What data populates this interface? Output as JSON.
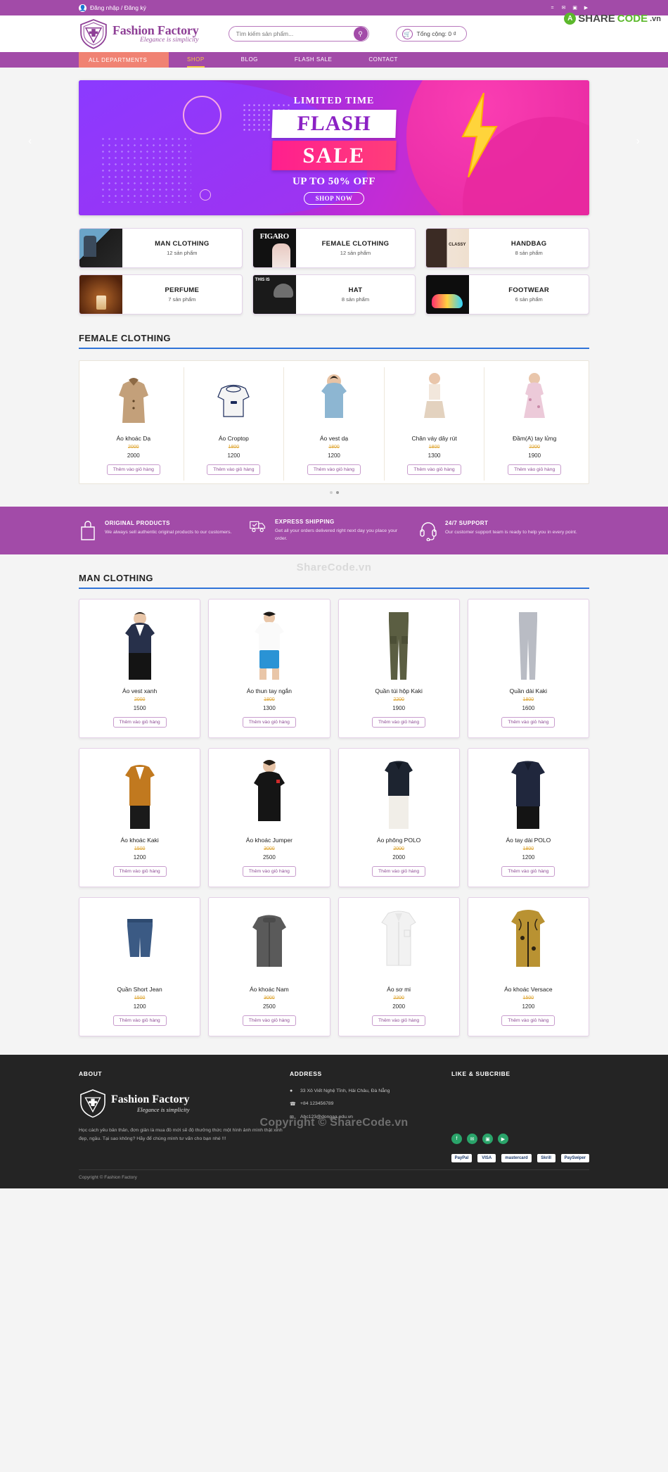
{
  "topbar": {
    "account_label": "Đăng nhập / Đăng ký",
    "user_icon": "user-icon",
    "socials": [
      "facebook-icon",
      "twitter-icon",
      "instagram-icon",
      "youtube-icon"
    ]
  },
  "sharecode": {
    "mark": "A",
    "share": "SHARE",
    "code": "CODE",
    "vn": ".vn"
  },
  "header": {
    "logo_title": "Fashion Factory",
    "logo_sub": "Elegance is simplicity",
    "search_placeholder": "Tìm kiếm sản phẩm...",
    "search_value": "",
    "search_icon": "search-icon",
    "cart_icon": "cart-icon",
    "cart_label": "Tổng cộng: 0 ₫"
  },
  "nav": {
    "all_departments": "ALL DEPARTMENTS",
    "links": [
      {
        "label": "SHOP",
        "active": true
      },
      {
        "label": "BLOG",
        "active": false
      },
      {
        "label": "FLASH SALE",
        "active": false
      },
      {
        "label": "CONTACT",
        "active": false
      }
    ]
  },
  "hero": {
    "limited": "LIMITED TIME",
    "flash": "FLASH",
    "sale": "SALE",
    "upto": "UP TO 50% OFF",
    "shop_now": "SHOP NOW",
    "prev_icon": "chevron-left-icon",
    "next_icon": "chevron-right-icon"
  },
  "categories": [
    {
      "name": "MAN CLOTHING",
      "count": "12 sản phẩm",
      "thumb": "th-man"
    },
    {
      "name": "FEMALE CLOTHING",
      "count": "12 sản phẩm",
      "thumb": "th-female"
    },
    {
      "name": "HANDBAG",
      "count": "8 sản phẩm",
      "thumb": "th-bag"
    },
    {
      "name": "PERFUME",
      "count": "7 sản phẩm",
      "thumb": "th-perfume"
    },
    {
      "name": "HAT",
      "count": "8 sản phẩm",
      "thumb": "th-hat"
    },
    {
      "name": "FOOTWEAR",
      "count": "6 sản phẩm",
      "thumb": "th-shoe"
    }
  ],
  "female_section": {
    "title": "FEMALE CLOTHING",
    "add_to_cart": "Thêm vào giỏ hàng",
    "products": [
      {
        "name": "Áo khoác Dạ",
        "old_price": "2000",
        "price": "2000",
        "color": "#c3a07a",
        "shape": "coat"
      },
      {
        "name": "Áo Croptop",
        "old_price": "1800",
        "price": "1200",
        "color": "#f2f2f2",
        "shape": "top"
      },
      {
        "name": "Áo vest dạ",
        "old_price": "1800",
        "price": "1200",
        "color": "#8db6d2",
        "shape": "denim"
      },
      {
        "name": "Chân váy dây rút",
        "old_price": "1800",
        "price": "1300",
        "color": "#e8d8c8",
        "shape": "skirt"
      },
      {
        "name": "Đầm(A) tay lửng",
        "old_price": "2200",
        "price": "1900",
        "color": "#e9c7d6",
        "shape": "dress"
      }
    ],
    "carousel_dots": 2,
    "active_dot": 1
  },
  "services": [
    {
      "icon": "bag-icon",
      "title": "ORIGINAL PRODUCTS",
      "desc": "We always sell authentic original products to our customers."
    },
    {
      "icon": "truck-icon",
      "title": "EXPRESS SHIPPING",
      "desc": "Get all your orders delivered right next day you place your order."
    },
    {
      "icon": "headset-icon",
      "title": "24/7 SUPPORT",
      "desc": "Our customer support team is ready to help you in every point."
    }
  ],
  "man_section": {
    "title": "MAN CLOTHING",
    "watermark": "ShareCode.vn",
    "add_to_cart": "Thêm vào giỏ hàng",
    "products": [
      {
        "name": "Áo vest xanh",
        "old_price": "2000",
        "price": "1500",
        "color": "#27304a",
        "shape": "suit"
      },
      {
        "name": "Áo thun tay ngắn",
        "old_price": "1800",
        "price": "1300",
        "color": "#2a93d5",
        "shape": "tshirt"
      },
      {
        "name": "Quần túi hộp Kaki",
        "old_price": "2200",
        "price": "1900",
        "color": "#5b5e42",
        "shape": "cargo"
      },
      {
        "name": "Quần dài Kaki",
        "old_price": "1800",
        "price": "1600",
        "color": "#b9bcc4",
        "shape": "pants"
      },
      {
        "name": "Áo khoác Kaki",
        "old_price": "1500",
        "price": "1200",
        "color": "#c1791f",
        "shape": "jacket"
      },
      {
        "name": "Áo khoác Jumper",
        "old_price": "3000",
        "price": "2500",
        "color": "#151515",
        "shape": "jumper"
      },
      {
        "name": "Áo phông POLO",
        "old_price": "2000",
        "price": "2000",
        "color": "#1d2430",
        "shape": "polo"
      },
      {
        "name": "Áo tay dài POLO",
        "old_price": "1800",
        "price": "1200",
        "color": "#20273d",
        "shape": "longpolo"
      },
      {
        "name": "Quần Short Jean",
        "old_price": "1500",
        "price": "1200",
        "color": "#3b5a84",
        "shape": "short"
      },
      {
        "name": "Áo khoác Nam",
        "old_price": "3000",
        "price": "2500",
        "color": "#5a5a5a",
        "shape": "coatman"
      },
      {
        "name": "Áo sơ mi",
        "old_price": "2200",
        "price": "2000",
        "color": "#f0f0f0",
        "shape": "shirt"
      },
      {
        "name": "Áo khoác Versace",
        "old_price": "1500",
        "price": "1200",
        "color": "#b99232",
        "shape": "versace"
      }
    ]
  },
  "footer": {
    "about_head": "ABOUT",
    "address_head": "ADDRESS",
    "like_head": "LIKE & SUBCRIBE",
    "logo_title": "Fashion Factory",
    "logo_sub": "Elegance is simplicity",
    "about_text": "Học cách yêu bản thân, đơn giản là mua đồ mới sẽ độ thưởng thức một hình ảnh mình thật xinh đẹp, ngầu. Tại sao không? Hãy để chúng mình tư vấn cho bạn nhé !!!",
    "address": "33 Xô Viết Nghệ Tĩnh, Hải Châu, Đà Nẵng",
    "phone": "+84 123456789",
    "email": "Abc123@dongaa.edu.vn",
    "address_icon": "location-icon",
    "phone_icon": "phone-icon",
    "email_icon": "mail-icon",
    "socials": [
      {
        "icon": "facebook-icon",
        "color": "#2aa46a"
      },
      {
        "icon": "twitter-icon",
        "color": "#2aa46a"
      },
      {
        "icon": "instagram-icon",
        "color": "#2aa46a"
      },
      {
        "icon": "youtube-icon",
        "color": "#2aa46a"
      }
    ],
    "payments": [
      "PayPal",
      "VISA",
      "mastercard",
      "Skrill",
      "PaySwiper"
    ],
    "copyright": "Copyright © Fashion Factory",
    "overlay_copyright": "Copyright © ShareCode.vn"
  }
}
